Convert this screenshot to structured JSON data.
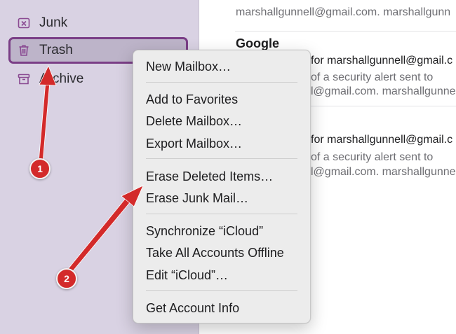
{
  "sidebar": {
    "items": [
      {
        "label": "Junk",
        "icon": "junk-icon"
      },
      {
        "label": "Trash",
        "icon": "trash-icon",
        "selected": true
      },
      {
        "label": "Archive",
        "icon": "archive-icon"
      }
    ]
  },
  "messages": {
    "top_snippet": "marshallgunnell@gmail.com. marshallgunn",
    "items": [
      {
        "sender": "Google",
        "line1": "for marshallgunnell@gmail.c",
        "line2": "of a security alert sent to",
        "line3": "l@gmail.com. marshallgunnell"
      },
      {
        "sender": "",
        "line1": "for marshallgunnell@gmail.c",
        "line2": "of a security alert sent to",
        "line3": "l@gmail.com. marshallgunnell"
      }
    ]
  },
  "context_menu": {
    "groups": [
      [
        "New Mailbox…"
      ],
      [
        "Add to Favorites",
        "Delete Mailbox…",
        "Export Mailbox…"
      ],
      [
        "Erase Deleted Items…",
        "Erase Junk Mail…"
      ],
      [
        "Synchronize “iCloud”",
        "Take All Accounts Offline",
        "Edit “iCloud”…"
      ],
      [
        "Get Account Info"
      ]
    ]
  },
  "annotations": {
    "badge1": "1",
    "badge2": "2",
    "color": "#d32a2a"
  },
  "colors": {
    "sidebar_bg": "#d9d2e3",
    "selection_border": "#7a3e86",
    "menu_bg": "#ececec"
  }
}
